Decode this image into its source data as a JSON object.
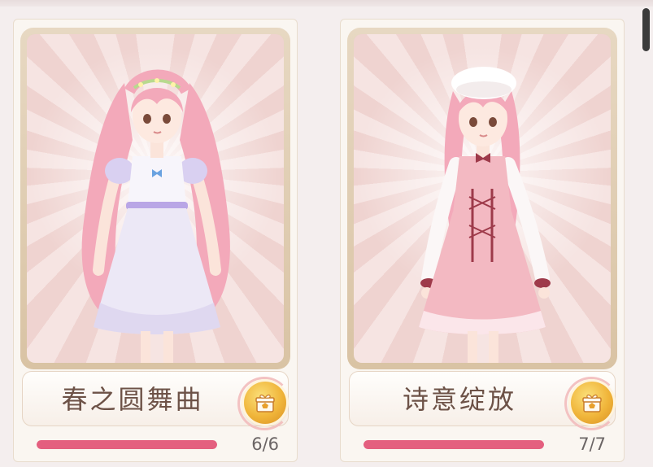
{
  "cards": [
    {
      "name": "春之圆舞曲",
      "collected": 6,
      "total": 6,
      "count_label": "6/6",
      "progress": 1.0,
      "gift_icon": "gift-box-icon",
      "character": {
        "hair_color": "#f3a9ba",
        "dress_color": "#ece8f6",
        "accent_color": "#b9a6e6"
      }
    },
    {
      "name": "诗意绽放",
      "collected": 7,
      "total": 7,
      "count_label": "7/7",
      "progress": 1.0,
      "gift_icon": "gift-box-icon",
      "character": {
        "hair_color": "#f3a9ba",
        "dress_color": "#f3b9c2",
        "accent_color": "#9e3a4a"
      }
    }
  ],
  "colors": {
    "progress_fill": "#e45f7f",
    "name_text": "#6d5247",
    "gift_gold": "#f0b53a"
  }
}
